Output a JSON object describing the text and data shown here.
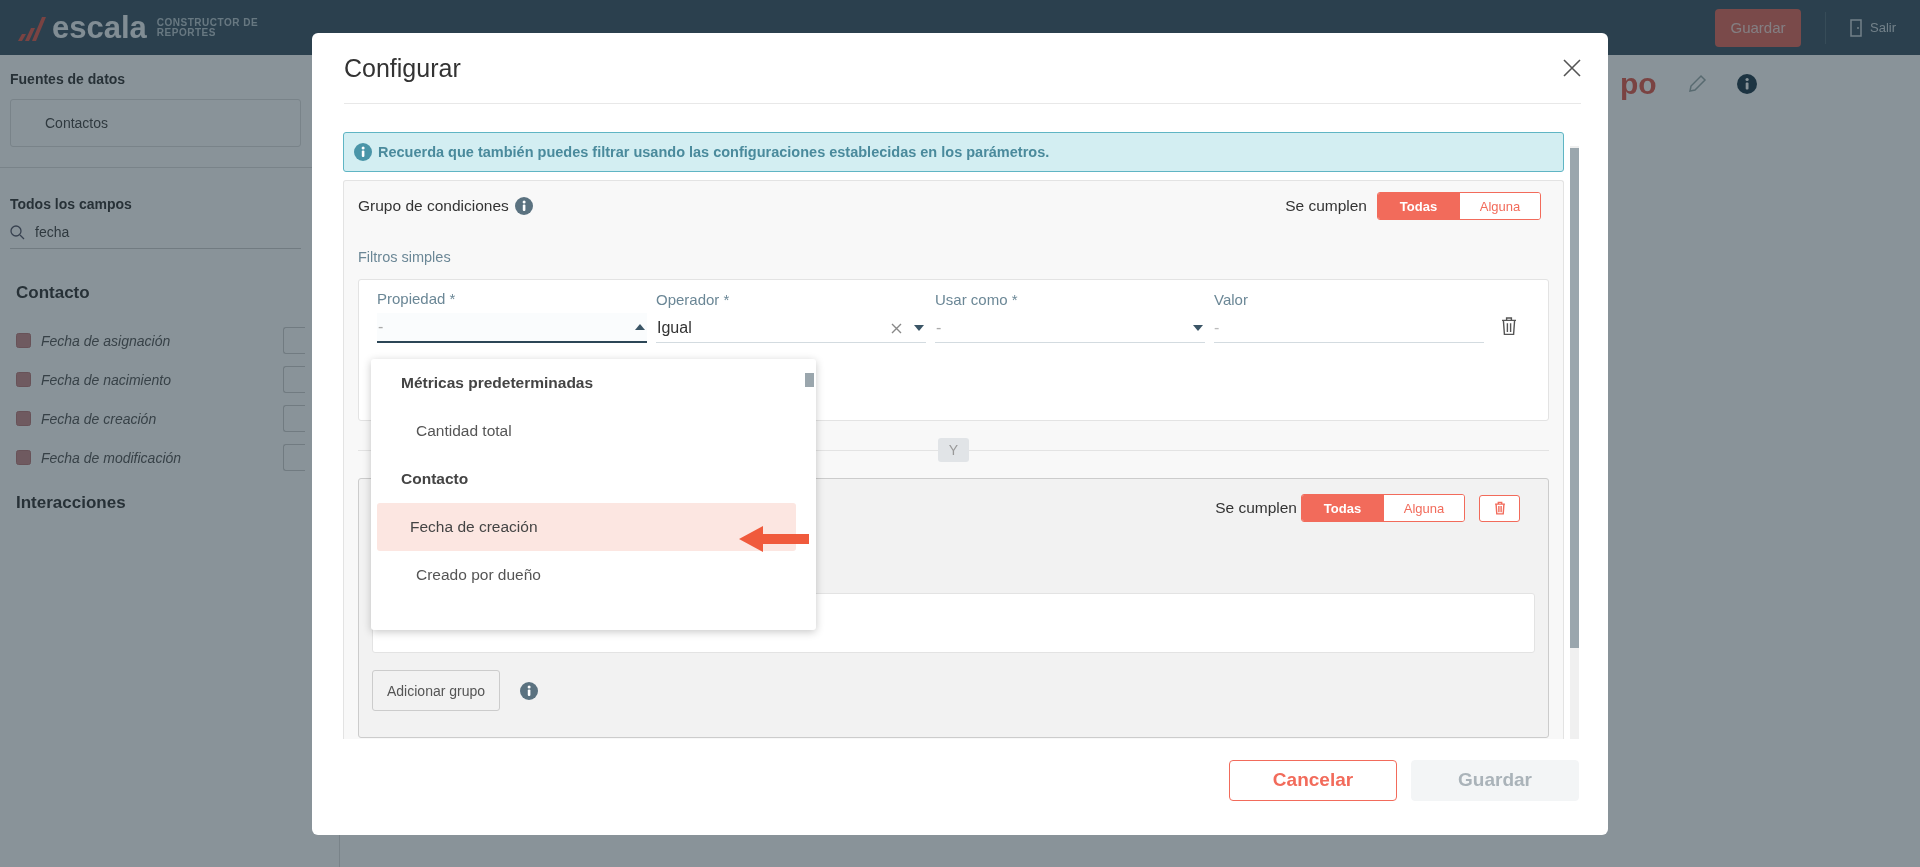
{
  "app_header": {
    "logo": "escala",
    "subtitle": "CONSTRUCTOR DE REPORTES",
    "save_button": "Guardar",
    "exit_button": "Salir"
  },
  "sidebar": {
    "data_sources_label": "Fuentes de datos",
    "data_source": "Contactos",
    "fields_label": "Todos los campos",
    "search_value": "fecha",
    "sections": [
      {
        "title": "Contacto",
        "items": [
          {
            "label": "Fecha de asignación"
          },
          {
            "label": "Fecha de nacimiento"
          },
          {
            "label": "Fecha de creación"
          },
          {
            "label": "Fecha de modificación"
          }
        ]
      },
      {
        "title": "Interacciones"
      }
    ]
  },
  "report_title_fragment": "po",
  "dialog": {
    "title": "Configurar",
    "info_alert": "Recuerda que también puedes filtrar usando las configuraciones establecidas en los parámetros.",
    "condition_group": {
      "title": "Grupo de condiciones",
      "match_label": "Se cumplen",
      "match_options": [
        {
          "label": "Todas",
          "selected": true
        },
        {
          "label": "Alguna",
          "selected": false
        }
      ],
      "simple_filters_label": "Filtros simples",
      "filter_fields": [
        {
          "kind": "select",
          "label": "Propiedad *",
          "placeholder": "-",
          "open": true
        },
        {
          "kind": "clearable-select",
          "label": "Operador *",
          "value": "Igual",
          "open": false
        },
        {
          "kind": "select",
          "label": "Usar como *",
          "placeholder": "-",
          "open": false
        },
        {
          "kind": "input",
          "label": "Valor",
          "placeholder": "-"
        }
      ],
      "dropdown": [
        {
          "kind": "header",
          "label": "Métricas predeterminadas"
        },
        {
          "kind": "option",
          "label": "Cantidad total",
          "highlighted": false
        },
        {
          "kind": "header",
          "label": "Contacto"
        },
        {
          "kind": "option",
          "label": "Fecha de creación",
          "highlighted": true
        },
        {
          "kind": "option",
          "label": "Creado por dueño",
          "highlighted": false
        }
      ],
      "joiner": "Y",
      "nested_group": {
        "match_label": "Se cumplen",
        "match_options": [
          {
            "label": "Todas",
            "selected": true
          },
          {
            "label": "Alguna",
            "selected": false
          }
        ]
      },
      "add_group_button": "Adicionar grupo"
    },
    "buttons": [
      {
        "kind": "secondary",
        "label": "Cancelar",
        "disabled": false
      },
      {
        "kind": "primary",
        "label": "Guardar",
        "disabled": true
      }
    ]
  }
}
